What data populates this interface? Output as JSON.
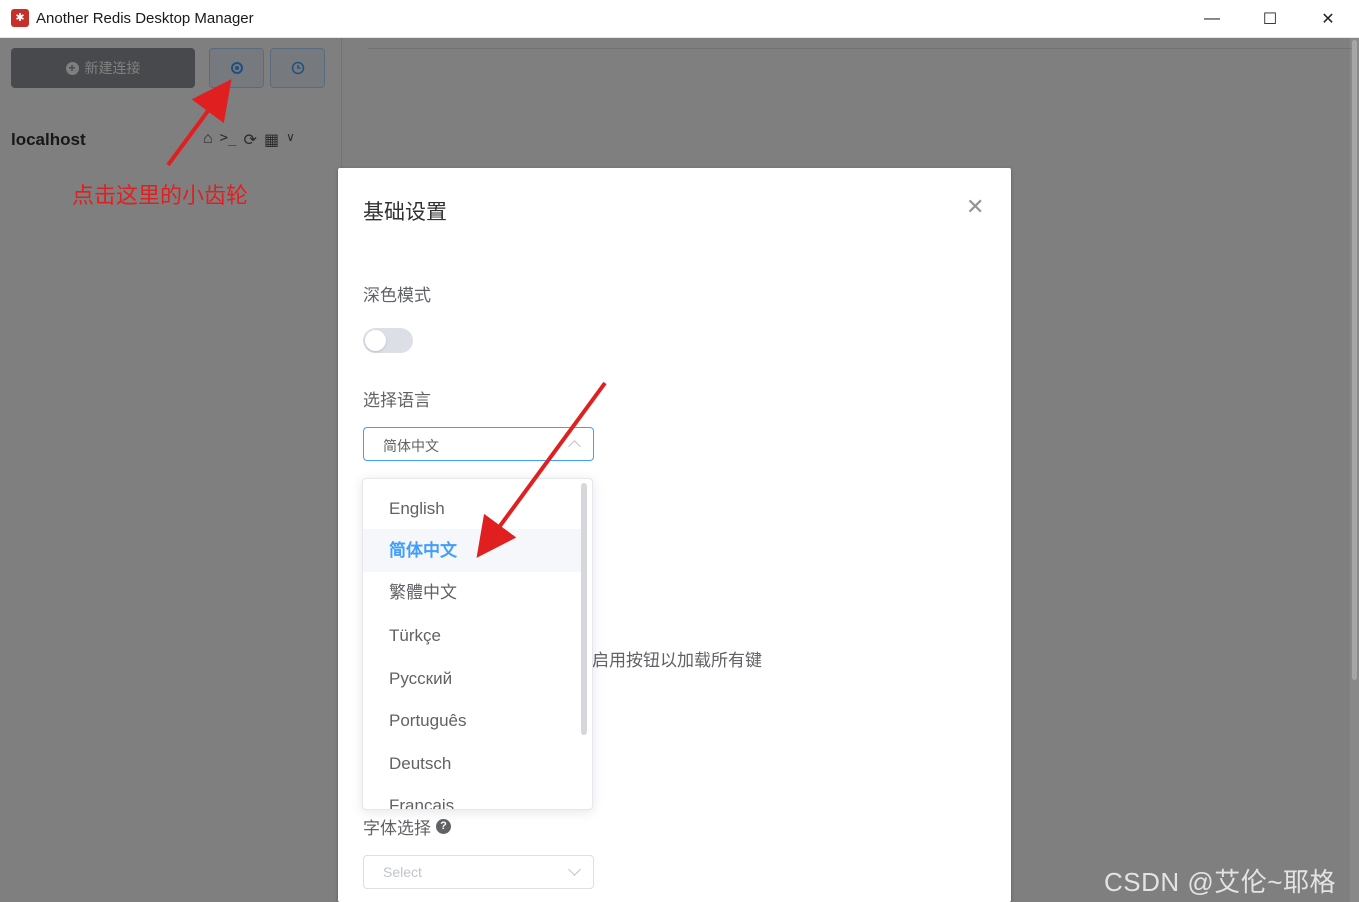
{
  "window": {
    "title": "Another Redis Desktop Manager",
    "minimize_glyph": "—",
    "maximize_glyph": "☐",
    "close_glyph": "✕"
  },
  "sidebar": {
    "new_connection_label": "新建连接",
    "settings_icon": "gear-icon",
    "history_icon": "clock-icon",
    "connection_name": "localhost",
    "connection_tools": [
      "home-icon",
      "terminal-icon",
      "refresh-icon",
      "grid-icon",
      "chevron-down-icon"
    ]
  },
  "dialog": {
    "title": "基础设置",
    "dark_mode_label": "深色模式",
    "dark_mode_on": false,
    "language_label": "选择语言",
    "language_value": "简体中文",
    "partial_hidden_text": "启用按钮以加载所有键",
    "font_label": "字体选择",
    "font_placeholder": "Select"
  },
  "language_dropdown": {
    "options": [
      "English",
      "简体中文",
      "繁體中文",
      "Türkçe",
      "Русский",
      "Português",
      "Deutsch",
      "Français"
    ],
    "selected": "简体中文"
  },
  "annotations": {
    "gear_hint": "点击这里的小齿轮",
    "color": "#e02020"
  },
  "watermark": "CSDN @艾伦~耶格尔",
  "colors": {
    "accent": "#409eff",
    "redis_red": "#c6302b"
  }
}
